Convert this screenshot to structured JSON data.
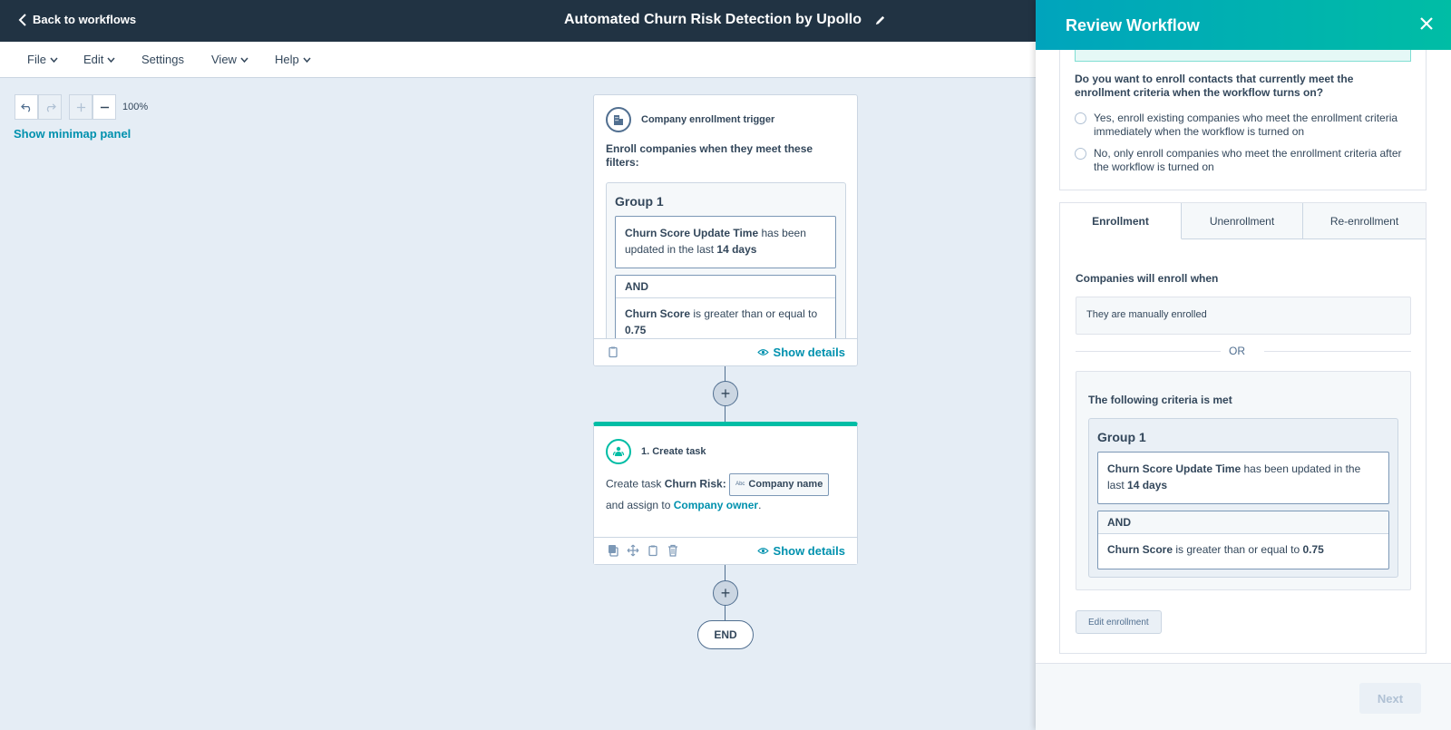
{
  "topbar": {
    "back_label": "Back to workflows",
    "workflow_title": "Automated Churn Risk Detection by Upollo"
  },
  "menu": {
    "file": "File",
    "edit": "Edit",
    "settings": "Settings",
    "view": "View",
    "help": "Help"
  },
  "canvas": {
    "zoom_level": "100%",
    "minimap_link": "Show minimap panel",
    "trigger_card": {
      "title": "Company enrollment trigger",
      "description": "Enroll companies when they meet these filters:",
      "group_title": "Group 1",
      "filter1_property": "Churn Score Update Time",
      "filter1_text": "has been updated in the last",
      "filter1_value": "14 days",
      "and_label": "AND",
      "filter2_property": "Churn Score",
      "filter2_text": "is greater than or equal to",
      "filter2_value": "0.75",
      "show_details": "Show details"
    },
    "task_card": {
      "title": "1. Create task",
      "create_text": "Create task",
      "task_name": "Churn Risk:",
      "token_abbr": "Abc",
      "token_label": "Company name",
      "assign_text": "and assign to",
      "owner_link": "Company owner",
      "period": ".",
      "show_details": "Show details"
    },
    "plus_symbol": "+",
    "end_label": "END"
  },
  "panel": {
    "title": "Review Workflow",
    "question": "Do you want to enroll contacts that currently meet the enrollment criteria when the workflow turns on?",
    "option_yes": "Yes, enroll existing companies who meet the enrollment criteria immediately when the workflow is turned on",
    "option_no": "No, only enroll companies who meet the enrollment criteria after the workflow is turned on",
    "tabs": [
      "Enrollment",
      "Unenrollment",
      "Re-enrollment"
    ],
    "enroll_when_label": "Companies will enroll when",
    "manual_enroll": "They are manually enrolled",
    "or_label": "OR",
    "criteria_label": "The following criteria is met",
    "group_title": "Group 1",
    "filter1_property": "Churn Score Update Time",
    "filter1_text": "has been updated in the last",
    "filter1_value": "14 days",
    "and_label": "AND",
    "filter2_property": "Churn Score",
    "filter2_text": "is greater than or equal to",
    "filter2_value": "0.75",
    "edit_enrollment": "Edit enrollment",
    "next_label": "Next"
  },
  "colors": {
    "topbar": "#213343",
    "accent": "#0091ae",
    "teal": "#00bda5",
    "canvas_bg": "#e5edf5"
  }
}
